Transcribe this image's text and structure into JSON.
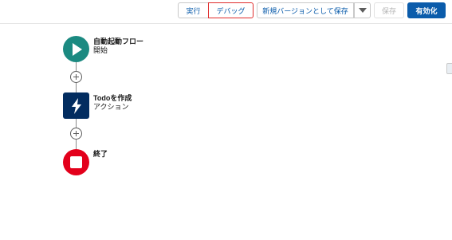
{
  "toolbar": {
    "run_label": "実行",
    "debug_label": "デバッグ",
    "save_as_new_version_label": "新規バージョンとして保存",
    "save_label": "保存",
    "activate_label": "有効化"
  },
  "flow": {
    "start": {
      "title": "自動起動フロー",
      "subtitle": "開始"
    },
    "action": {
      "title": "Todoを作成",
      "subtitle": "アクション"
    },
    "end": {
      "title": "終了"
    }
  },
  "colors": {
    "brand": "#0b5cab",
    "start_node": "#1b8a81",
    "action_node": "#032d60",
    "end_node": "#e3001b",
    "debug_border": "#e02c2c"
  },
  "icons": {
    "start": "play-icon",
    "action": "lightning-bolt-icon",
    "end": "stop-icon",
    "add": "add-element-icon",
    "menu": "chevron-down-icon"
  }
}
